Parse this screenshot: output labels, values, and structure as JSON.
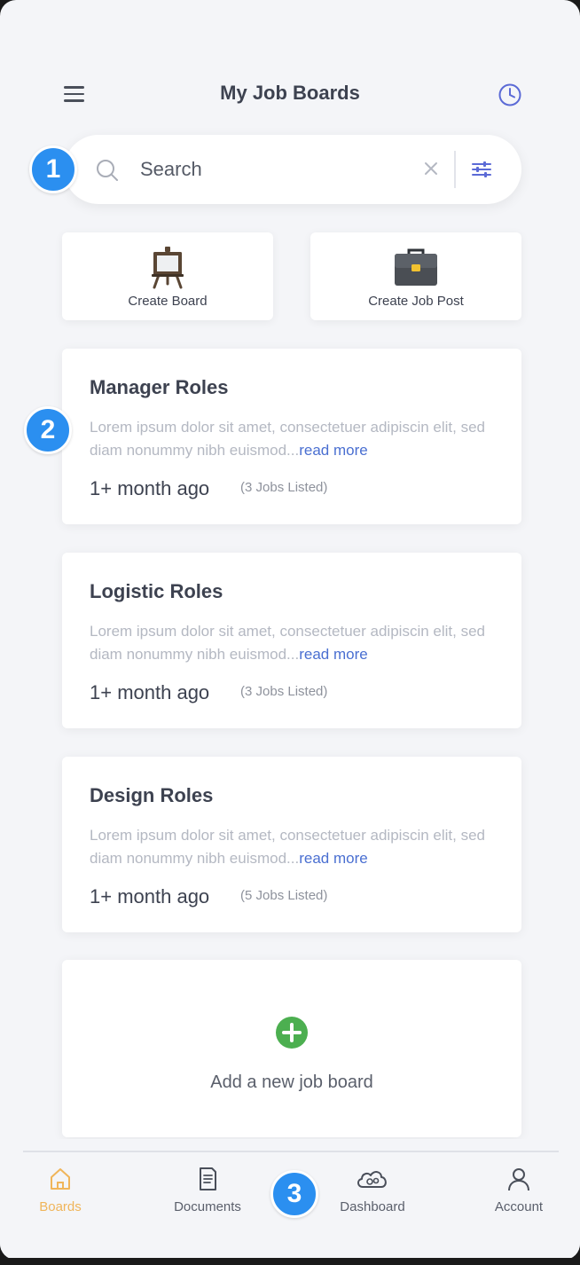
{
  "header": {
    "title": "My Job Boards"
  },
  "search": {
    "placeholder": "Search"
  },
  "quick_actions": [
    {
      "label": "Create Board",
      "icon": "easel-icon"
    },
    {
      "label": "Create Job Post",
      "icon": "briefcase-icon"
    }
  ],
  "boards": [
    {
      "title": "Manager Roles",
      "description": "Lorem ipsum dolor sit amet, consectetuer adipiscin elit, sed diam nonummy nibh euismod...",
      "read_more": "read more",
      "time": "1+ month ago",
      "count": "(3 Jobs Listed)"
    },
    {
      "title": "Logistic Roles",
      "description": "Lorem ipsum dolor sit amet, consectetuer adipiscin elit, sed diam nonummy nibh euismod...",
      "read_more": "read more",
      "time": "1+ month ago",
      "count": "(3 Jobs Listed)"
    },
    {
      "title": "Design Roles",
      "description": "Lorem ipsum dolor sit amet, consectetuer adipiscin elit, sed diam nonummy nibh euismod...",
      "read_more": "read more",
      "time": "1+ month ago",
      "count": "(5 Jobs Listed)"
    }
  ],
  "add_board": {
    "label": "Add a new job board",
    "icon": "plus-circle-icon"
  },
  "annotations": [
    "1",
    "2",
    "3"
  ],
  "bottom_nav": [
    {
      "label": "Boards",
      "icon": "home-icon",
      "active": true
    },
    {
      "label": "Documents",
      "icon": "document-icon",
      "active": false
    },
    {
      "label": "Dashboard",
      "icon": "cloud-icon",
      "active": false
    },
    {
      "label": "Account",
      "icon": "user-icon",
      "active": false
    }
  ],
  "colors": {
    "background": "#f4f5f8",
    "accent_blue": "#4a6fd1",
    "badge_blue": "#2b8ff0",
    "active_nav": "#f0b55a",
    "add_green": "#4caf50",
    "title_text": "#3d4250"
  }
}
